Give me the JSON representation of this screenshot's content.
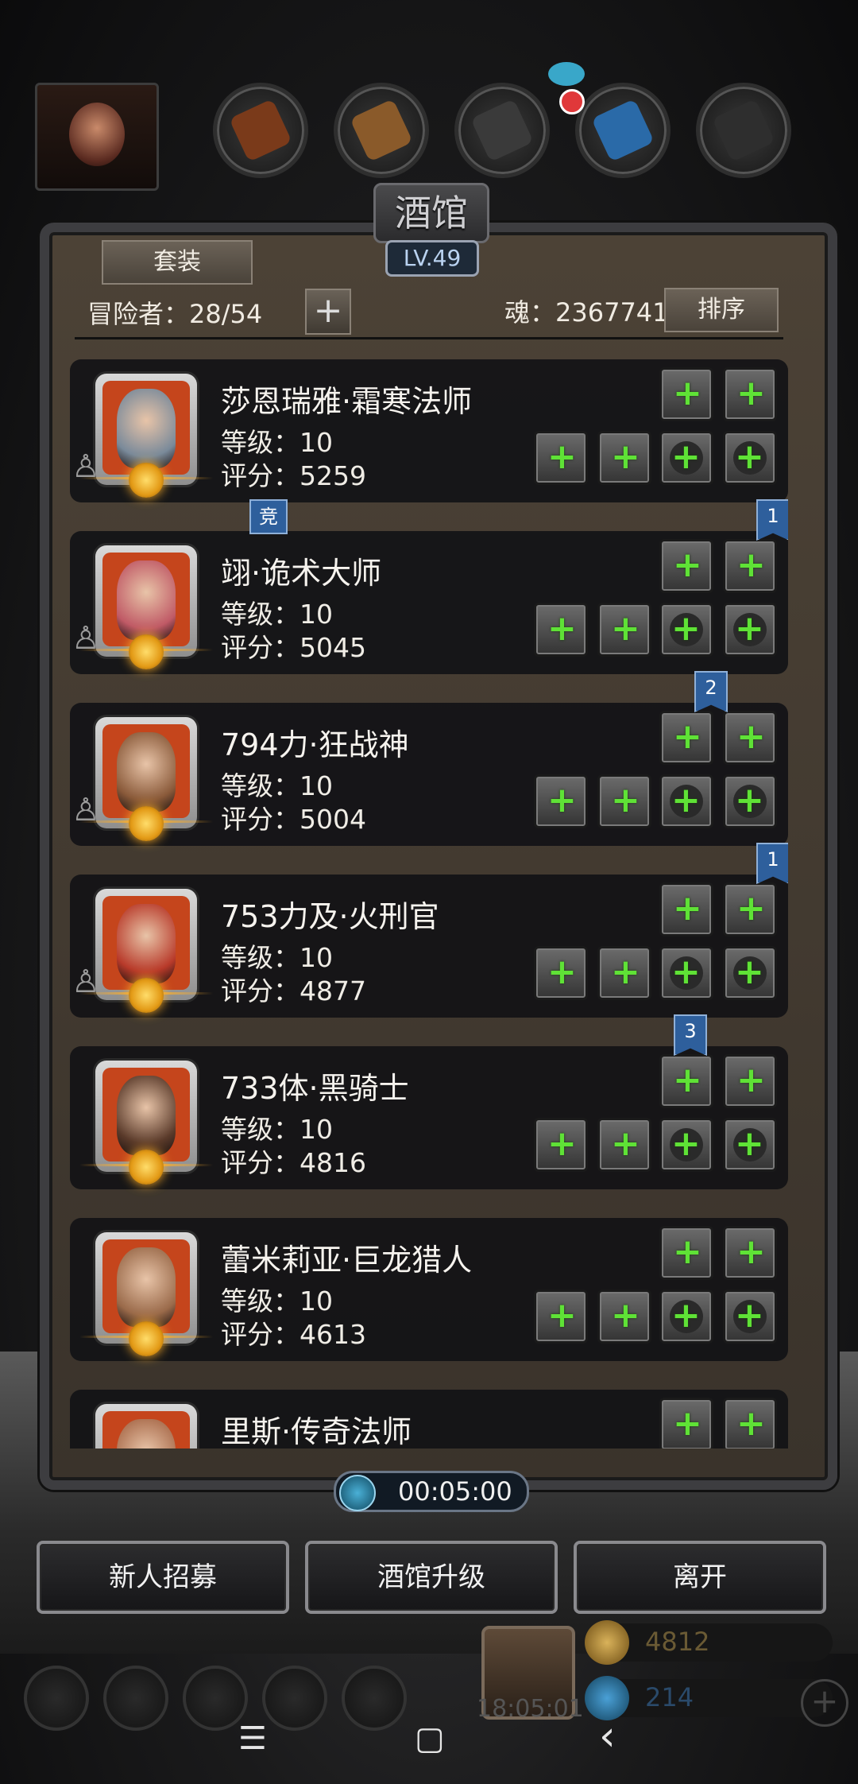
{
  "title": "酒馆",
  "level": "LV.49",
  "suit_label": "套装",
  "adventurers_label": "冒险者：28/54",
  "plus_symbol": "+",
  "soul_label": "魂：2367741",
  "sort_label": "排序",
  "heroes": [
    {
      "name": "莎恩瑞雅·霜寒法师",
      "level": "等级：10",
      "score": "评分：5259",
      "portrait_color": "#7a8a9a"
    },
    {
      "name": "翊·诡术大师",
      "level": "等级：10",
      "score": "评分：5045",
      "portrait_color": "#c05a66"
    },
    {
      "name": "794力·狂战神",
      "level": "等级：10",
      "score": "评分：5004",
      "portrait_color": "#8a5a3a"
    },
    {
      "name": "753力及·火刑官",
      "level": "等级：10",
      "score": "评分：4877",
      "portrait_color": "#b83a2a"
    },
    {
      "name": "733体·黑骑士",
      "level": "等级：10",
      "score": "评分：4816",
      "portrait_color": "#5a3a2a"
    },
    {
      "name": "蕾米莉亚·巨龙猎人",
      "level": "等级：10",
      "score": "评分：4613",
      "portrait_color": "#9a6a4a"
    },
    {
      "name": "里斯·传奇法师",
      "level": "",
      "score": "",
      "portrait_color": "#a86a4a"
    }
  ],
  "flags": {
    "f1": "竞",
    "f2": "1",
    "f3": "2",
    "f4": "1",
    "f5": "3"
  },
  "timer": "00:05:00",
  "buttons": {
    "recruit": "新人招募",
    "upgrade": "酒馆升级",
    "leave": "离开"
  },
  "resources": {
    "gold": "4812",
    "gem": "214"
  },
  "gift_time": "18:05:01",
  "nav": {
    "menu": "☰",
    "home": "▢",
    "back": "‹"
  },
  "colors": {
    "accent_green": "#5fe236",
    "flag_blue": "#2e5f9c",
    "medal_gold": "#e39a16"
  }
}
